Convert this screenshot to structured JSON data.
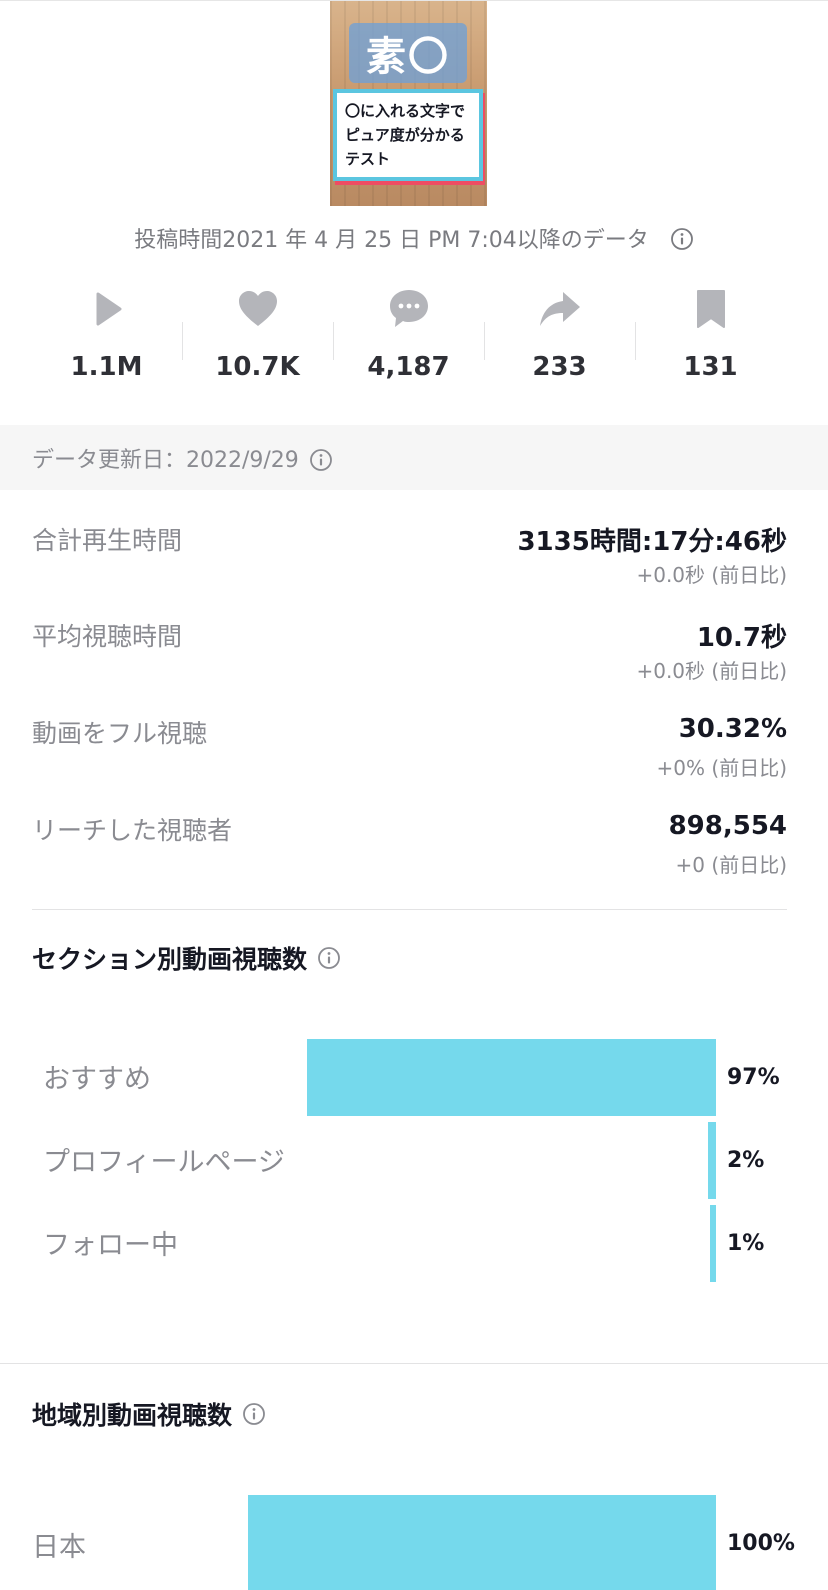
{
  "thumbnail": {
    "banner_text": "素〇",
    "caption_lines": [
      "〇に入れる文字で",
      "ピュア度が分かる",
      "テスト"
    ]
  },
  "posted_text": "投稿時間2021 年 4 月 25 日 PM 7:04以降のデータ",
  "metrics": [
    {
      "icon": "play-icon",
      "value": "1.1M"
    },
    {
      "icon": "heart-icon",
      "value": "10.7K"
    },
    {
      "icon": "comment-icon",
      "value": "4,187"
    },
    {
      "icon": "share-icon",
      "value": "233"
    },
    {
      "icon": "bookmark-icon",
      "value": "131"
    }
  ],
  "update_label": "データ更新日：2022/9/29",
  "stats": [
    {
      "label": "合計再生時間",
      "value": "3135時間:17分:46秒",
      "delta": "+0.0秒 (前日比)"
    },
    {
      "label": "平均視聴時間",
      "value": "10.7秒",
      "delta": "+0.0秒 (前日比)"
    },
    {
      "label": "動画をフル視聴",
      "value": "30.32%",
      "delta": "+0% (前日比)"
    },
    {
      "label": "リーチした視聴者",
      "value": "898,554",
      "delta": "+0 (前日比)"
    }
  ],
  "section_views": {
    "title": "セクション別動画視聴数",
    "rows": [
      {
        "label": "おすすめ",
        "percent_text": "97%",
        "percent": 97
      },
      {
        "label": "プロフィールページ",
        "percent_text": "2%",
        "percent": 2
      },
      {
        "label": "フォロー中",
        "percent_text": "1%",
        "percent": 1
      }
    ]
  },
  "region_views": {
    "title": "地域別動画視聴数",
    "rows": [
      {
        "label": "日本",
        "percent_text": "100%",
        "percent": 100
      }
    ]
  },
  "colors": {
    "bar": "#75d9ec",
    "icon_gray": "#b4b5ba",
    "band": "#f6f6f6"
  }
}
